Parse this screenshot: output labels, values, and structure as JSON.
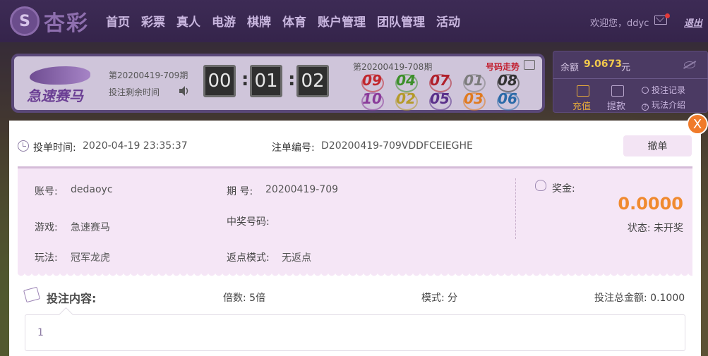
{
  "nav": {
    "logo_text": "杏彩",
    "items": [
      "首页",
      "彩票",
      "真人",
      "电游",
      "棋牌",
      "体育",
      "账户管理",
      "团队管理",
      "活动"
    ],
    "welcome": "欢迎您，ddyc",
    "logout": "退出"
  },
  "game": {
    "name": "急速赛马",
    "current_issue": "第20200419-709期",
    "remain_label": "投注剩余时间",
    "timer": [
      "00",
      "01",
      "02"
    ],
    "last_issue": "第20200419-708期",
    "trend_link": "号码走势",
    "balls": [
      {
        "num": "09",
        "color": "#c1272d"
      },
      {
        "num": "04",
        "color": "#3c8f2a"
      },
      {
        "num": "07",
        "color": "#b0202b"
      },
      {
        "num": "01",
        "color": "#7c7c7c"
      },
      {
        "num": "08",
        "color": "#333333"
      },
      {
        "num": "10",
        "color": "#8a3b9a"
      },
      {
        "num": "02",
        "color": "#b59a2a"
      },
      {
        "num": "05",
        "color": "#5a2f8a"
      },
      {
        "num": "03",
        "color": "#e07a1f"
      },
      {
        "num": "06",
        "color": "#2a6aa8"
      }
    ]
  },
  "balance": {
    "label": "余额",
    "amount": "9.0673",
    "unit": "元",
    "recharge": "充值",
    "withdraw": "提款",
    "bet_record": "投注记录",
    "rule_intro": "玩法介绍"
  },
  "modal": {
    "close": "X",
    "bet_time_label": "投单时间:",
    "bet_time_value": "2020-04-19 23:35:37",
    "order_no_label": "注单编号:",
    "order_no_value": "D20200419-709VDDFCEIEGHE",
    "cancel_button": "撤单",
    "account_label": "账号:",
    "account_value": "dedaoyc",
    "issue_label": "期 号:",
    "issue_value": "20200419-709",
    "game_label": "游戏:",
    "game_value": "急速赛马",
    "win_numbers_label": "中奖号码:",
    "play_label": "玩法:",
    "play_value": "冠军龙虎",
    "rebate_label": "返点模式:",
    "rebate_value": "无返点",
    "prize_label": "奖金:",
    "prize_value": "0.0000",
    "status_label": "状态: 未开奖",
    "content_title": "投注内容:",
    "multiple": "倍数: 5倍",
    "mode": "模式: 分",
    "total": "投注总金额: 0.1000",
    "content": "1"
  },
  "colors": {
    "accent_orange": "#f08a2f",
    "nav_bg": "#3d2b55",
    "detail_bg": "#f5e6f6"
  }
}
